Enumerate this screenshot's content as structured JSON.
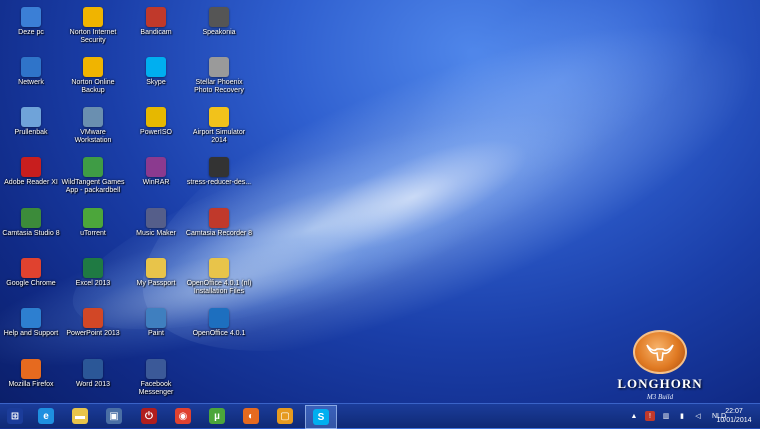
{
  "desktop_icons": [
    {
      "label": "Deze pc",
      "icon": "computer-icon",
      "color": "#3b7fd6"
    },
    {
      "label": "Netwerk",
      "icon": "network-icon",
      "color": "#2f74c9"
    },
    {
      "label": "Prullenbak",
      "icon": "recycle-bin-icon",
      "color": "#6fa3d9"
    },
    {
      "label": "Adobe Reader XI",
      "icon": "adobe-reader-icon",
      "color": "#c81e1e"
    },
    {
      "label": "Camtasia Studio 8",
      "icon": "camtasia-icon",
      "color": "#3c8b3a"
    },
    {
      "label": "Google Chrome",
      "icon": "chrome-icon",
      "color": "#e0422f"
    },
    {
      "label": "Help and Support",
      "icon": "help-icon",
      "color": "#2d7fd0"
    },
    {
      "label": "Mozilla Firefox",
      "icon": "firefox-icon",
      "color": "#e66a1f"
    },
    {
      "label": "Norton Internet\nSecurity",
      "icon": "norton-icon",
      "color": "#f0b400"
    },
    {
      "label": "Norton Online\nBackup",
      "icon": "norton-backup-icon",
      "color": "#f0b400"
    },
    {
      "label": "VMware\nWorkstation",
      "icon": "vmware-icon",
      "color": "#6a8fb0"
    },
    {
      "label": "WildTangent Games\nApp - packardbell",
      "icon": "wildtangent-icon",
      "color": "#3f9c45"
    },
    {
      "label": "uTorrent",
      "icon": "utorrent-icon",
      "color": "#4ca63b"
    },
    {
      "label": "Excel 2013",
      "icon": "excel-icon",
      "color": "#1f7a43"
    },
    {
      "label": "PowerPoint 2013",
      "icon": "powerpoint-icon",
      "color": "#d24726"
    },
    {
      "label": "Word 2013",
      "icon": "word-icon",
      "color": "#2b5797"
    },
    {
      "label": "Bandicam",
      "icon": "bandicam-icon",
      "color": "#c0392b"
    },
    {
      "label": "Skype",
      "icon": "skype-icon",
      "color": "#00aff0"
    },
    {
      "label": "PowerISO",
      "icon": "poweriso-icon",
      "color": "#e6b800"
    },
    {
      "label": "WinRAR",
      "icon": "winrar-icon",
      "color": "#8b3a8f"
    },
    {
      "label": "Music Maker",
      "icon": "music-maker-icon",
      "color": "#555e8a"
    },
    {
      "label": "My Passport",
      "icon": "folder-icon",
      "color": "#e8c44a"
    },
    {
      "label": "Paint",
      "icon": "paint-icon",
      "color": "#3f7fbf"
    },
    {
      "label": "Facebook\nMessenger",
      "icon": "facebook-messenger-icon",
      "color": "#3b5998"
    },
    {
      "label": "Speakonia",
      "icon": "speakonia-icon",
      "color": "#555555"
    },
    {
      "label": "Stellar Phoenix\nPhoto Recovery",
      "icon": "stellar-icon",
      "color": "#9a9a9a"
    },
    {
      "label": "Airport Simulator\n2014",
      "icon": "airport-simulator-icon",
      "color": "#f2c21b"
    },
    {
      "label": "stress-reducer-des...",
      "icon": "shortcut-icon",
      "color": "#333333"
    },
    {
      "label": "Camtasia Recorder 8",
      "icon": "camtasia-recorder-icon",
      "color": "#c0392b"
    },
    {
      "label": "OpenOffice 4.0.1 (nl)\nInstallation Files",
      "icon": "folder-icon",
      "color": "#e8c44a"
    },
    {
      "label": "OpenOffice 4.0.1",
      "icon": "openoffice-icon",
      "color": "#1d6fbf"
    }
  ],
  "logo": {
    "name": "LONGHORN",
    "subtitle": "M3 Build"
  },
  "taskbar": {
    "items": [
      {
        "icon": "start-windows-icon",
        "glyph": "⊞",
        "color": "#1b3c9a"
      },
      {
        "icon": "internet-explorer-icon",
        "glyph": "e",
        "color": "#1e90e0"
      },
      {
        "icon": "file-explorer-icon",
        "glyph": "▬",
        "color": "#e8c44a"
      },
      {
        "icon": "control-panel-icon",
        "glyph": "▣",
        "color": "#4a6fa5"
      },
      {
        "icon": "power-icon",
        "glyph": "⏻",
        "color": "#b01e1e"
      },
      {
        "icon": "chrome-icon",
        "glyph": "◉",
        "color": "#e0422f"
      },
      {
        "icon": "utorrent-icon",
        "glyph": "µ",
        "color": "#4ca63b"
      },
      {
        "icon": "firefox-icon",
        "glyph": "◐",
        "color": "#e66a1f"
      },
      {
        "icon": "vmware-icon",
        "glyph": "▢",
        "color": "#e69a1f"
      },
      {
        "icon": "skype-icon",
        "glyph": "S",
        "color": "#00aff0",
        "active": true
      }
    ],
    "tray": {
      "icons": [
        "show-hidden-icon",
        "action-center-icon",
        "network-tray-icon",
        "battery-icon",
        "volume-icon"
      ],
      "language": "NLD",
      "time": "22:07",
      "date": "10/01/2014"
    }
  }
}
